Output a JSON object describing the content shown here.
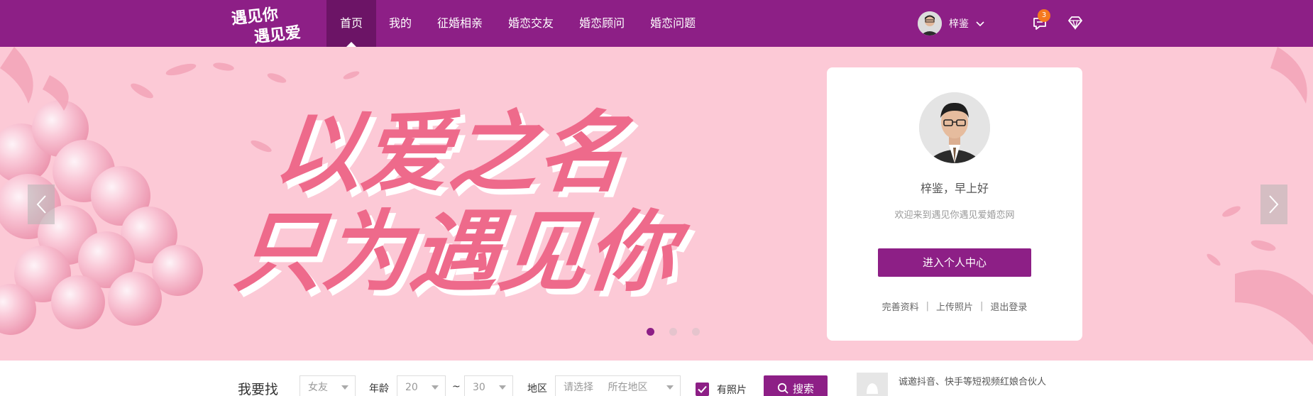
{
  "header": {
    "logo_text_1": "遇见你",
    "logo_text_2": "遇见爱",
    "nav": [
      {
        "label": "首页",
        "active": true
      },
      {
        "label": "我的"
      },
      {
        "label": "征婚相亲"
      },
      {
        "label": "婚恋交友"
      },
      {
        "label": "婚恋顾问"
      },
      {
        "label": "婚恋问题"
      }
    ],
    "user_name": "梓鉴",
    "message_count": "3",
    "colors": {
      "brand": "#8d1f86",
      "nav_active": "#6c1466",
      "badge": "#f5791f"
    }
  },
  "banner": {
    "headline_1": "以爱之名",
    "headline_2": "只为遇见你",
    "background": "#fcc9d6",
    "slides": 3,
    "active_slide": 1
  },
  "welcome_card": {
    "greeting": "梓鉴，早上好",
    "welcome_text": "欢迎来到遇见你遇见爱婚恋网",
    "center_button": "进入个人中心",
    "links": [
      "完善资料",
      "上传照片",
      "退出登录"
    ]
  },
  "search": {
    "title": "我要找",
    "gender": "女友",
    "age_label": "年龄",
    "age_from": "20",
    "age_sep": "~",
    "age_to": "30",
    "region_label": "地区",
    "region_placeholder": "请选择",
    "region_value": "所在地区",
    "photo_label": "有照片",
    "photo_checked": true,
    "button": "搜索"
  },
  "notice": {
    "line_1": "诚邀抖音、快手等短视频红娘合伙人"
  }
}
